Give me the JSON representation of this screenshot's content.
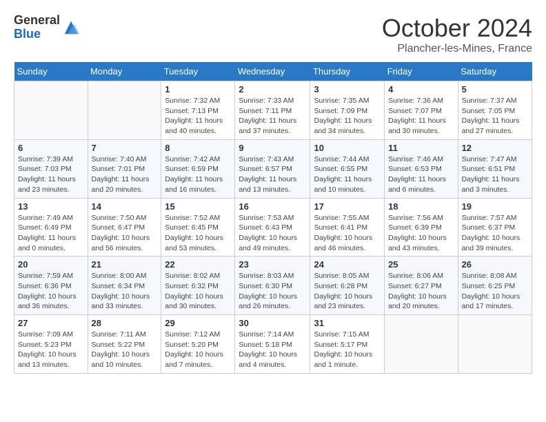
{
  "logo": {
    "general": "General",
    "blue": "Blue"
  },
  "title": {
    "month": "October 2024",
    "location": "Plancher-les-Mines, France"
  },
  "weekdays": [
    "Sunday",
    "Monday",
    "Tuesday",
    "Wednesday",
    "Thursday",
    "Friday",
    "Saturday"
  ],
  "weeks": [
    [
      {
        "day": "",
        "info": ""
      },
      {
        "day": "",
        "info": ""
      },
      {
        "day": "1",
        "info": "Sunrise: 7:32 AM\nSunset: 7:13 PM\nDaylight: 11 hours and 40 minutes."
      },
      {
        "day": "2",
        "info": "Sunrise: 7:33 AM\nSunset: 7:11 PM\nDaylight: 11 hours and 37 minutes."
      },
      {
        "day": "3",
        "info": "Sunrise: 7:35 AM\nSunset: 7:09 PM\nDaylight: 11 hours and 34 minutes."
      },
      {
        "day": "4",
        "info": "Sunrise: 7:36 AM\nSunset: 7:07 PM\nDaylight: 11 hours and 30 minutes."
      },
      {
        "day": "5",
        "info": "Sunrise: 7:37 AM\nSunset: 7:05 PM\nDaylight: 11 hours and 27 minutes."
      }
    ],
    [
      {
        "day": "6",
        "info": "Sunrise: 7:39 AM\nSunset: 7:03 PM\nDaylight: 11 hours and 23 minutes."
      },
      {
        "day": "7",
        "info": "Sunrise: 7:40 AM\nSunset: 7:01 PM\nDaylight: 11 hours and 20 minutes."
      },
      {
        "day": "8",
        "info": "Sunrise: 7:42 AM\nSunset: 6:59 PM\nDaylight: 11 hours and 16 minutes."
      },
      {
        "day": "9",
        "info": "Sunrise: 7:43 AM\nSunset: 6:57 PM\nDaylight: 11 hours and 13 minutes."
      },
      {
        "day": "10",
        "info": "Sunrise: 7:44 AM\nSunset: 6:55 PM\nDaylight: 11 hours and 10 minutes."
      },
      {
        "day": "11",
        "info": "Sunrise: 7:46 AM\nSunset: 6:53 PM\nDaylight: 11 hours and 6 minutes."
      },
      {
        "day": "12",
        "info": "Sunrise: 7:47 AM\nSunset: 6:51 PM\nDaylight: 11 hours and 3 minutes."
      }
    ],
    [
      {
        "day": "13",
        "info": "Sunrise: 7:49 AM\nSunset: 6:49 PM\nDaylight: 11 hours and 0 minutes."
      },
      {
        "day": "14",
        "info": "Sunrise: 7:50 AM\nSunset: 6:47 PM\nDaylight: 10 hours and 56 minutes."
      },
      {
        "day": "15",
        "info": "Sunrise: 7:52 AM\nSunset: 6:45 PM\nDaylight: 10 hours and 53 minutes."
      },
      {
        "day": "16",
        "info": "Sunrise: 7:53 AM\nSunset: 6:43 PM\nDaylight: 10 hours and 49 minutes."
      },
      {
        "day": "17",
        "info": "Sunrise: 7:55 AM\nSunset: 6:41 PM\nDaylight: 10 hours and 46 minutes."
      },
      {
        "day": "18",
        "info": "Sunrise: 7:56 AM\nSunset: 6:39 PM\nDaylight: 10 hours and 43 minutes."
      },
      {
        "day": "19",
        "info": "Sunrise: 7:57 AM\nSunset: 6:37 PM\nDaylight: 10 hours and 39 minutes."
      }
    ],
    [
      {
        "day": "20",
        "info": "Sunrise: 7:59 AM\nSunset: 6:36 PM\nDaylight: 10 hours and 36 minutes."
      },
      {
        "day": "21",
        "info": "Sunrise: 8:00 AM\nSunset: 6:34 PM\nDaylight: 10 hours and 33 minutes."
      },
      {
        "day": "22",
        "info": "Sunrise: 8:02 AM\nSunset: 6:32 PM\nDaylight: 10 hours and 30 minutes."
      },
      {
        "day": "23",
        "info": "Sunrise: 8:03 AM\nSunset: 6:30 PM\nDaylight: 10 hours and 26 minutes."
      },
      {
        "day": "24",
        "info": "Sunrise: 8:05 AM\nSunset: 6:28 PM\nDaylight: 10 hours and 23 minutes."
      },
      {
        "day": "25",
        "info": "Sunrise: 8:06 AM\nSunset: 6:27 PM\nDaylight: 10 hours and 20 minutes."
      },
      {
        "day": "26",
        "info": "Sunrise: 8:08 AM\nSunset: 6:25 PM\nDaylight: 10 hours and 17 minutes."
      }
    ],
    [
      {
        "day": "27",
        "info": "Sunrise: 7:09 AM\nSunset: 5:23 PM\nDaylight: 10 hours and 13 minutes."
      },
      {
        "day": "28",
        "info": "Sunrise: 7:11 AM\nSunset: 5:22 PM\nDaylight: 10 hours and 10 minutes."
      },
      {
        "day": "29",
        "info": "Sunrise: 7:12 AM\nSunset: 5:20 PM\nDaylight: 10 hours and 7 minutes."
      },
      {
        "day": "30",
        "info": "Sunrise: 7:14 AM\nSunset: 5:18 PM\nDaylight: 10 hours and 4 minutes."
      },
      {
        "day": "31",
        "info": "Sunrise: 7:15 AM\nSunset: 5:17 PM\nDaylight: 10 hours and 1 minute."
      },
      {
        "day": "",
        "info": ""
      },
      {
        "day": "",
        "info": ""
      }
    ]
  ]
}
